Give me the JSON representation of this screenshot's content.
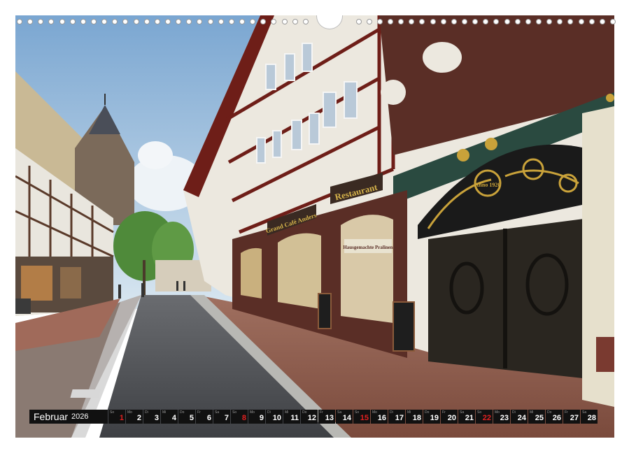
{
  "calendar": {
    "month": "Februar",
    "year": "2026",
    "days": [
      {
        "n": "1",
        "wd": "So",
        "sun": true
      },
      {
        "n": "2",
        "wd": "Mo",
        "sun": false
      },
      {
        "n": "3",
        "wd": "Di",
        "sun": false
      },
      {
        "n": "4",
        "wd": "Mi",
        "sun": false
      },
      {
        "n": "5",
        "wd": "Do",
        "sun": false
      },
      {
        "n": "6",
        "wd": "Fr",
        "sun": false
      },
      {
        "n": "7",
        "wd": "Sa",
        "sun": false
      },
      {
        "n": "8",
        "wd": "So",
        "sun": true
      },
      {
        "n": "9",
        "wd": "Mo",
        "sun": false
      },
      {
        "n": "10",
        "wd": "Di",
        "sun": false
      },
      {
        "n": "11",
        "wd": "Mi",
        "sun": false
      },
      {
        "n": "12",
        "wd": "Do",
        "sun": false
      },
      {
        "n": "13",
        "wd": "Fr",
        "sun": false
      },
      {
        "n": "14",
        "wd": "Sa",
        "sun": false
      },
      {
        "n": "15",
        "wd": "So",
        "sun": true
      },
      {
        "n": "16",
        "wd": "Mo",
        "sun": false
      },
      {
        "n": "17",
        "wd": "Di",
        "sun": false
      },
      {
        "n": "18",
        "wd": "Mi",
        "sun": false
      },
      {
        "n": "19",
        "wd": "Do",
        "sun": false
      },
      {
        "n": "20",
        "wd": "Fr",
        "sun": false
      },
      {
        "n": "21",
        "wd": "Sa",
        "sun": false
      },
      {
        "n": "22",
        "wd": "So",
        "sun": true
      },
      {
        "n": "23",
        "wd": "Mo",
        "sun": false
      },
      {
        "n": "24",
        "wd": "Di",
        "sun": false
      },
      {
        "n": "25",
        "wd": "Mi",
        "sun": false
      },
      {
        "n": "26",
        "wd": "Do",
        "sun": false
      },
      {
        "n": "27",
        "wd": "Fr",
        "sun": false
      },
      {
        "n": "28",
        "wd": "Sa",
        "sun": false
      }
    ]
  },
  "signs": {
    "restaurant": "Restaurant",
    "cafe": "Grand Café Anders",
    "window_sign": "Hausgemachte Pralinen",
    "door_plaque": "Anno 1920"
  },
  "colors": {
    "sky_top": "#8fb3d6",
    "timber_red": "#6e1e18",
    "plaster": "#ece8df",
    "door": "#2a2620",
    "gold": "#c9a23a",
    "road": "#4a4c50",
    "pavement": "#8b5a4a",
    "calendar_bg": "#111111",
    "sunday": "#e02020"
  }
}
